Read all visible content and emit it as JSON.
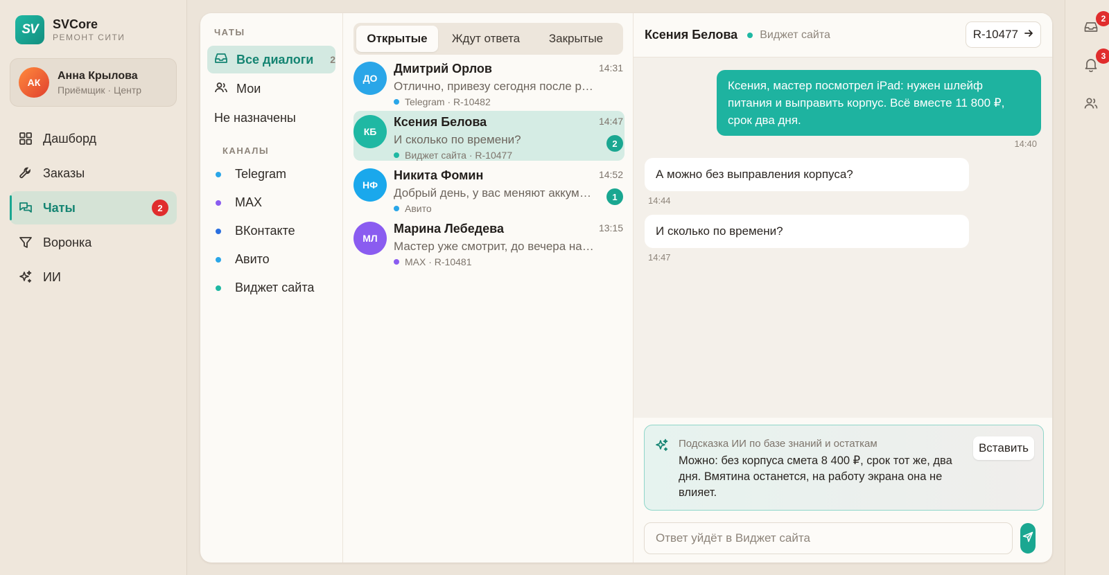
{
  "brand": {
    "logo_text": "SV",
    "name": "SVCore",
    "subtitle": "РЕМОНТ СИТИ"
  },
  "user": {
    "initials": "АК",
    "name": "Анна Крылова",
    "role": "Приёмщик · Центр"
  },
  "nav": [
    {
      "label": "Дашборд",
      "icon": "dashboard-icon"
    },
    {
      "label": "Заказы",
      "icon": "wrench-icon"
    },
    {
      "label": "Чаты",
      "icon": "chat-icon",
      "badge": "2",
      "active": true
    },
    {
      "label": "Воронка",
      "icon": "funnel-icon"
    },
    {
      "label": "ИИ",
      "icon": "sparkle-icon"
    }
  ],
  "filters": {
    "title": "ЧАТЫ",
    "items": [
      {
        "label": "Все диалоги",
        "count": "2",
        "active": true
      },
      {
        "label": "Мои"
      },
      {
        "label": "Не назначены"
      }
    ],
    "channels_title": "КАНАЛЫ",
    "channels": [
      {
        "label": "Telegram",
        "color": "#2aa6e8"
      },
      {
        "label": "MAX",
        "color": "#8a5cf0"
      },
      {
        "label": "ВКонтакте",
        "color": "#2a6fe0"
      },
      {
        "label": "Авито",
        "color": "#2aa6e8"
      },
      {
        "label": "Виджет сайта",
        "color": "#1fb8a3"
      }
    ]
  },
  "tabs": [
    "Открытые",
    "Ждут ответа",
    "Закрытые"
  ],
  "conversations": [
    {
      "initials": "ДО",
      "avatar_color": "#2aa6e8",
      "name": "Дмитрий Орлов",
      "time": "14:31",
      "preview": "Отлично, привезу сегодня после работы",
      "meta": "Telegram · R-10482",
      "meta_color": "#2aa6e8"
    },
    {
      "initials": "КБ",
      "avatar_color": "#1fb8a3",
      "name": "Ксения Белова",
      "time": "14:47",
      "preview": "И сколько по времени?",
      "meta": "Виджет сайта · R-10477",
      "meta_color": "#1fb8a3",
      "unread": "2",
      "active": true
    },
    {
      "initials": "НФ",
      "avatar_color": "#1aa8ec",
      "name": "Никита Фомин",
      "time": "14:52",
      "preview": "Добрый день, у вас меняют аккумулятор?",
      "meta": "Авито",
      "meta_color": "#2aa6e8",
      "unread": "1"
    },
    {
      "initials": "МЛ",
      "avatar_color": "#8a5cf0",
      "name": "Марина Лебедева",
      "time": "13:15",
      "preview": "Мастер уже смотрит, до вечера напишем",
      "meta": "MAX · R-10481",
      "meta_color": "#8a5cf0"
    }
  ],
  "chat": {
    "name": "Ксения Белова",
    "channel": "Виджет сайта",
    "channel_color": "#1fb8a3",
    "order_id": "R-10477",
    "messages": [
      {
        "direction": "out",
        "text": "Ксения, мастер посмотрел iPad: нужен шлейф питания и выправить корпус. Всё вместе 11 800 ₽, срок два дня.",
        "time": "14:40"
      },
      {
        "direction": "in",
        "text": "А можно без выправления корпуса?",
        "time": "14:44"
      },
      {
        "direction": "in",
        "text": "И сколько по времени?",
        "time": "14:47"
      }
    ],
    "ai_hint": {
      "title": "Подсказка ИИ по базе знаний и остаткам",
      "text": "Можно: без корпуса смета 8 400 ₽, срок тот же, два дня. Вмятина останется, на работу экрана она не влияет.",
      "insert_label": "Вставить"
    },
    "reply_placeholder": "Ответ уйдёт в Виджет сайта"
  },
  "rail": {
    "inbox_badge": "2",
    "bell_badge": "3"
  },
  "colors": {
    "accent": "#1aa791",
    "danger": "#e02d2d"
  }
}
